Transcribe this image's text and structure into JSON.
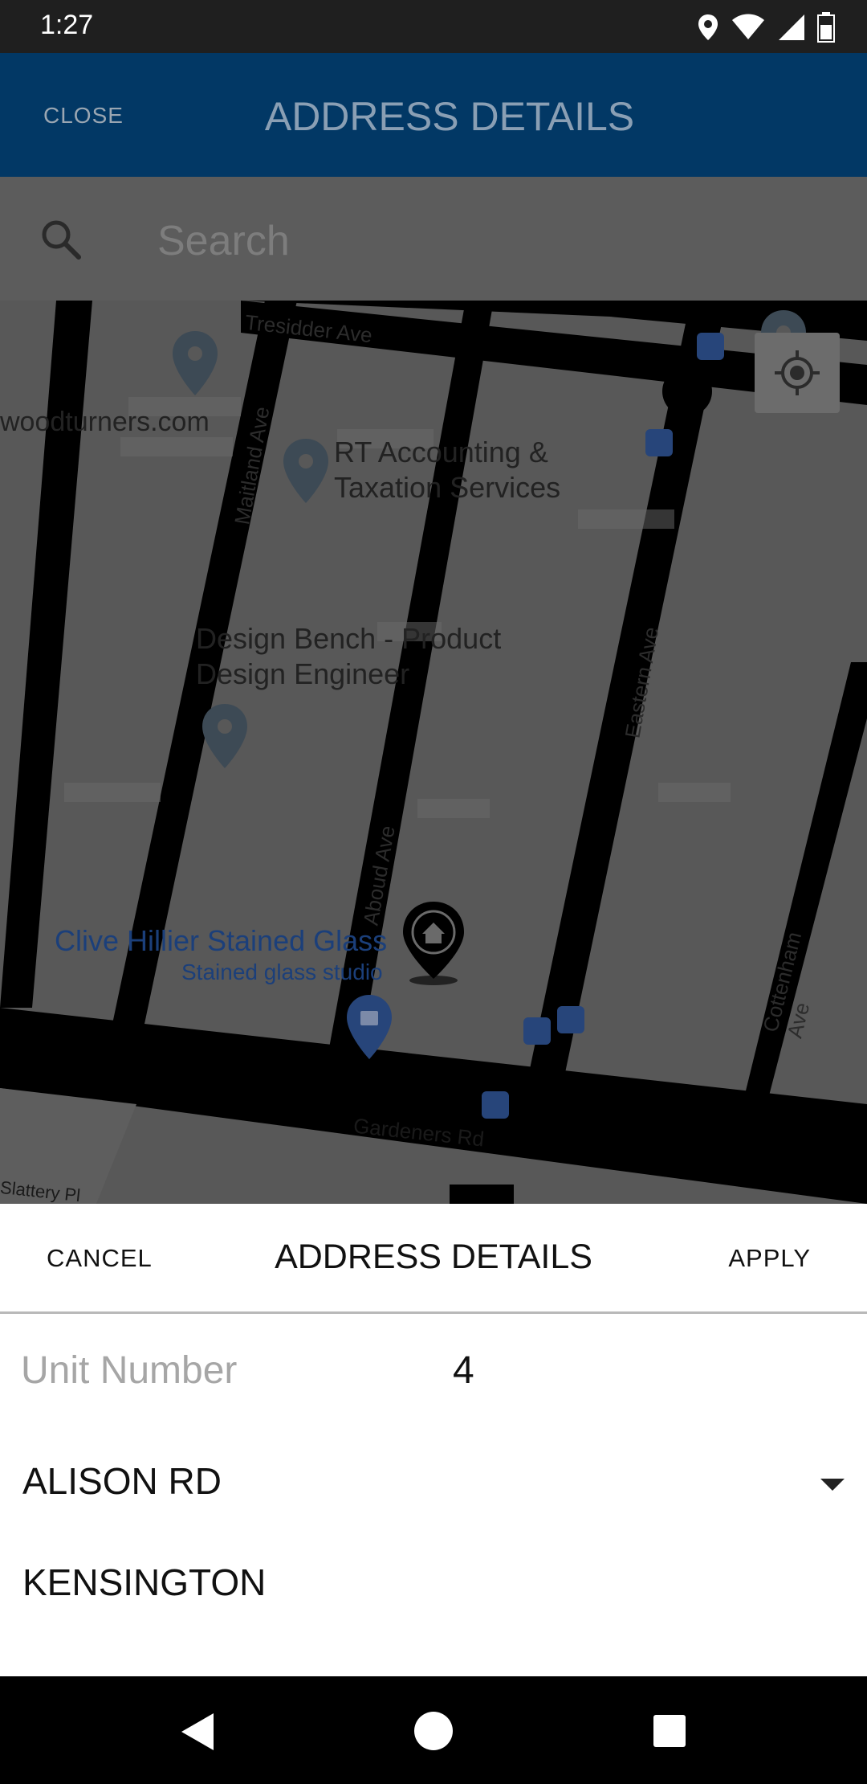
{
  "status_bar": {
    "time": "1:27",
    "icons": [
      "location-icon",
      "wifi-icon",
      "signal-icon",
      "battery-icon"
    ]
  },
  "app_bar": {
    "close_label": "CLOSE",
    "title": "ADDRESS DETAILS"
  },
  "search": {
    "placeholder": "Search",
    "icon": "search-icon"
  },
  "map": {
    "streets": [
      "Tresidder Ave",
      "Maitland Ave",
      "Aboud Ave",
      "Eastern Ave",
      "Cottenham Ave",
      "Gardeners Rd",
      "Slattery Pl"
    ],
    "places": [
      {
        "name": "woodturners.com"
      },
      {
        "name": "RT Accounting &",
        "name2": "Taxation Services"
      },
      {
        "name": "Design Bench - Product",
        "name2": "Design Engineer"
      },
      {
        "name": "Clive Hillier Stained Glass",
        "subtitle": "Stained glass studio"
      }
    ],
    "my_location_icon": "my-location-icon",
    "marker_icon": "home-marker-icon"
  },
  "sheet": {
    "cancel_label": "CANCEL",
    "title": "ADDRESS DETAILS",
    "apply_label": "APPLY",
    "unit_label": "Unit Number",
    "unit_value": "4",
    "street_value": "ALISON RD",
    "suburb_value": "KENSINGTON"
  },
  "nav_bar": {
    "icons": [
      "back-icon",
      "home-icon",
      "recents-icon"
    ]
  }
}
